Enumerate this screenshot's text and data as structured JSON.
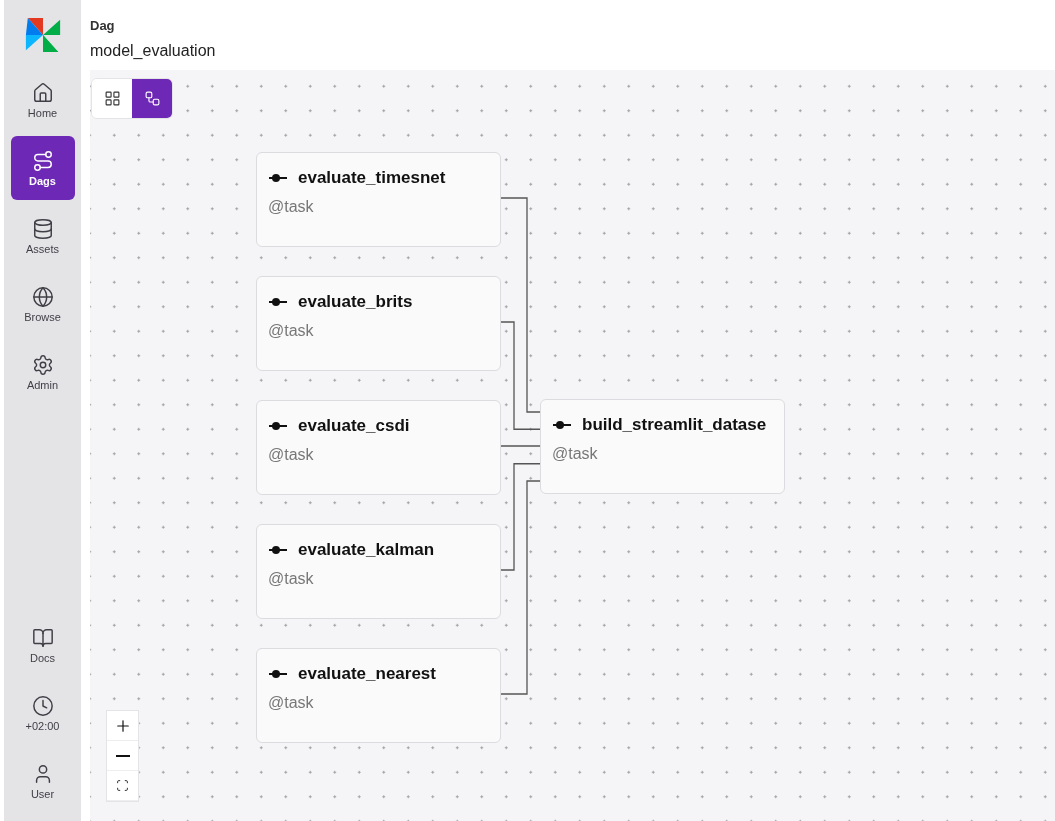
{
  "sidebar": {
    "top_items": [
      {
        "label": "Home",
        "kind": "home",
        "selected": false
      },
      {
        "label": "Dags",
        "kind": "dags",
        "selected": true
      },
      {
        "label": "Assets",
        "kind": "assets",
        "selected": false
      },
      {
        "label": "Browse",
        "kind": "browse",
        "selected": false
      },
      {
        "label": "Admin",
        "kind": "admin",
        "selected": false
      }
    ],
    "bottom_items": [
      {
        "label": "Docs",
        "kind": "docs",
        "selected": false
      },
      {
        "label": "+02:00",
        "kind": "clock",
        "selected": false
      },
      {
        "label": "User",
        "kind": "user",
        "selected": false
      }
    ]
  },
  "header": {
    "label": "Dag",
    "title": "model_evaluation"
  },
  "view_toggle": [
    {
      "kind": "grid",
      "selected": false
    },
    {
      "kind": "graph",
      "selected": true
    }
  ],
  "graph": {
    "upstream_tasks": [
      {
        "name": "evaluate_timesnet",
        "decorator": "@task"
      },
      {
        "name": "evaluate_brits",
        "decorator": "@task"
      },
      {
        "name": "evaluate_csdi",
        "decorator": "@task"
      },
      {
        "name": "evaluate_kalman",
        "decorator": "@task"
      },
      {
        "name": "evaluate_nearest",
        "decorator": "@task"
      }
    ],
    "downstream_task": {
      "name": "build_streamlit_datase",
      "decorator": "@task"
    }
  },
  "zoom_controls": [
    {
      "kind": "zoom_in"
    },
    {
      "kind": "zoom_out"
    },
    {
      "kind": "fit"
    }
  ]
}
